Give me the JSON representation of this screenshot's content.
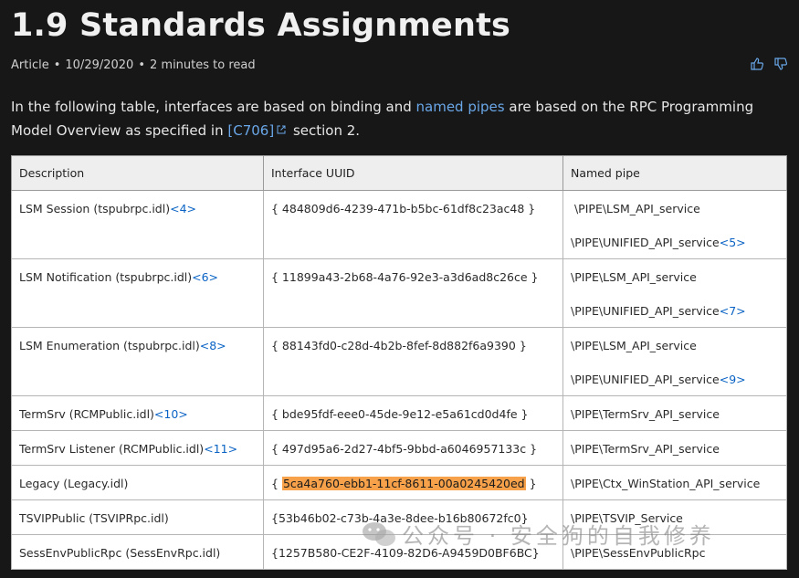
{
  "article": {
    "title": "1.9 Standards Assignments",
    "type": "Article",
    "date": "10/29/2020",
    "read_time": "2 minutes to read"
  },
  "intro": {
    "part1": "In the following table, interfaces are based on binding and",
    "link1": "named pipes",
    "part2": "are based on the RPC Programming Model Overview as specified in",
    "link2": "[C706]",
    "part3": "section 2."
  },
  "table": {
    "headers": [
      "Description",
      "Interface UUID",
      "Named pipe"
    ],
    "rows": [
      {
        "desc": "LSM Session (tspubrpc.idl)",
        "ref": "<4>",
        "uuid": "{ 484809d6-4239-471b-b5bc-61df8c23ac48 }",
        "pipe1": " \\PIPE\\LSM_API_service",
        "pipe2": "\\PIPE\\UNIFIED_API_service",
        "pipe2_ref": "<5>"
      },
      {
        "desc": "LSM Notification (tspubrpc.idl)",
        "ref": "<6>",
        "uuid": "{ 11899a43-2b68-4a76-92e3-a3d6ad8c26ce }",
        "pipe1": "\\PIPE\\LSM_API_service",
        "pipe2": "\\PIPE\\UNIFIED_API_service",
        "pipe2_ref": "<7>"
      },
      {
        "desc": "LSM Enumeration (tspubrpc.idl)",
        "ref": "<8>",
        "uuid": "{ 88143fd0-c28d-4b2b-8fef-8d882f6a9390 }",
        "pipe1": "\\PIPE\\LSM_API_service",
        "pipe2": "\\PIPE\\UNIFIED_API_service",
        "pipe2_ref": "<9>"
      },
      {
        "desc": "TermSrv (RCMPublic.idl)",
        "ref": "<10>",
        "uuid": "{ bde95fdf-eee0-45de-9e12-e5a61cd0d4fe }",
        "pipe1": "\\PIPE\\TermSrv_API_service"
      },
      {
        "desc": "TermSrv Listener (RCMPublic.idl)",
        "ref": "<11>",
        "uuid": "{ 497d95a6-2d27-4bf5-9bbd-a6046957133c }",
        "pipe1": "\\PIPE\\TermSrv_API_service"
      },
      {
        "desc": "Legacy (Legacy.idl)",
        "uuid_prefix": "{ ",
        "uuid_highlight": "5ca4a760-ebb1-11cf-8611-00a0245420ed",
        "uuid_suffix": " }",
        "pipe1": "\\PIPE\\Ctx_WinStation_API_service"
      },
      {
        "desc": "TSVIPPublic (TSVIPRpc.idl)",
        "uuid": "{53b46b02-c73b-4a3e-8dee-b16b80672fc0}",
        "pipe1": "\\PIPE\\TSVIP_Service"
      },
      {
        "desc": "SessEnvPublicRpc (SessEnvRpc.idl)",
        "uuid": "{1257B580-CE2F-4109-82D6-A9459D0BF6BC}",
        "pipe1": "\\PIPE\\SessEnvPublicRpc"
      }
    ]
  },
  "watermark": {
    "text": "公众号 · 安全狗的自我修养"
  },
  "icons": {
    "feedback_up": "thumbs-up-icon",
    "feedback_down": "thumbs-down-icon",
    "external": "external-link-icon"
  },
  "colors": {
    "link": "#6aa7e8",
    "ref": "#0a63c4",
    "highlight": "#f7a24a"
  }
}
